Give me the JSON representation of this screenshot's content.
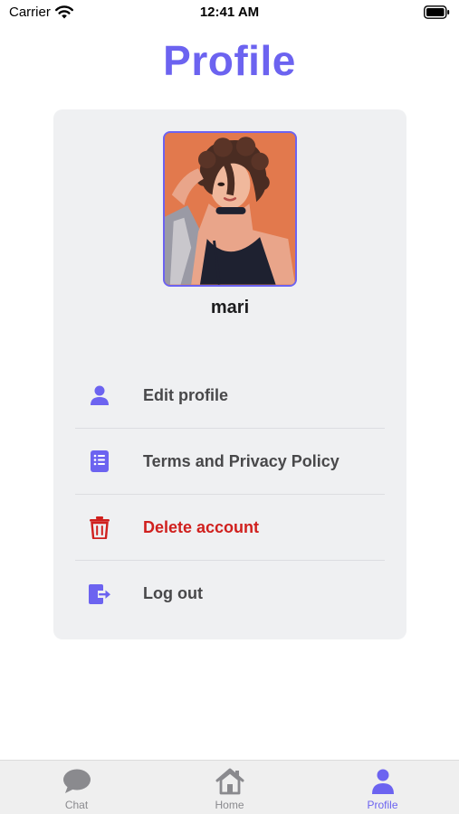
{
  "status_bar": {
    "carrier": "Carrier",
    "time": "12:41 AM"
  },
  "header": {
    "title": "Profile"
  },
  "profile": {
    "username": "mari",
    "avatar_icon": "user-portrait-illustration"
  },
  "menu": {
    "items": [
      {
        "label": "Edit profile",
        "icon": "person-icon"
      },
      {
        "label": "Terms and Privacy Policy",
        "icon": "document-list-icon"
      },
      {
        "label": "Delete account",
        "icon": "trash-icon"
      },
      {
        "label": "Log out",
        "icon": "logout-icon"
      }
    ]
  },
  "tab_bar": {
    "tabs": [
      {
        "label": "Chat",
        "icon": "chat-bubble-icon",
        "active": false
      },
      {
        "label": "Home",
        "icon": "home-icon",
        "active": false
      },
      {
        "label": "Profile",
        "icon": "person-icon",
        "active": true
      }
    ]
  },
  "colors": {
    "accent": "#6c63f0",
    "danger": "#d0201e",
    "card_background": "#eff0f2",
    "inactive_tab": "#8a8a8e"
  }
}
